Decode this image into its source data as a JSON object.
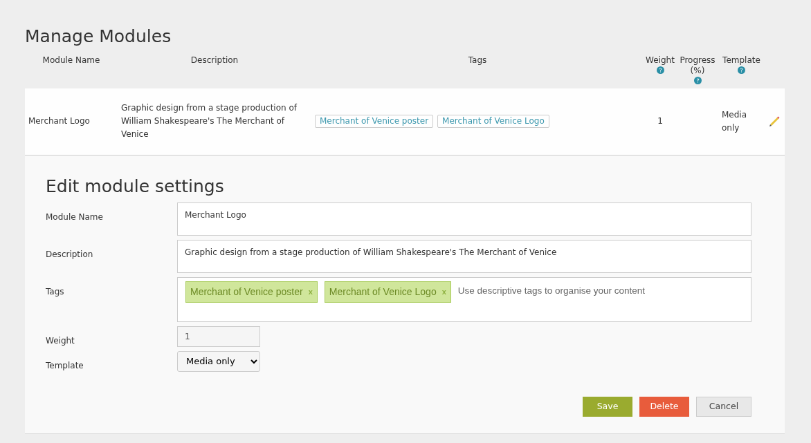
{
  "page_title": "Manage Modules",
  "table": {
    "columns": [
      {
        "label": "Module Name",
        "help": false
      },
      {
        "label": "Description",
        "help": false
      },
      {
        "label": "Tags",
        "help": false
      },
      {
        "label": "Weight",
        "help": true
      },
      {
        "label": "Progress (%)",
        "help": true
      },
      {
        "label": "Template",
        "help": true
      }
    ],
    "rows": [
      {
        "name": "Merchant Logo",
        "description": "Graphic design from a stage production of William Shakespeare's The Merchant of Venice",
        "tags": [
          "Merchant of Venice poster",
          "Merchant of Venice Logo"
        ],
        "weight": "1",
        "template": "Media only",
        "expanded": true
      }
    ]
  },
  "edit_form": {
    "title": "Edit module settings",
    "fields": [
      {
        "kind": "textarea",
        "label": "Module Name",
        "value": "Merchant Logo"
      },
      {
        "kind": "textarea",
        "label": "Description",
        "value": "Graphic design from a stage production of William Shakespeare's The Merchant of Venice"
      },
      {
        "kind": "tags",
        "label": "Tags",
        "tags": [
          {
            "label": "Merchant of Venice poster",
            "remove": "x"
          },
          {
            "label": "Merchant of Venice Logo",
            "remove": "x"
          }
        ],
        "placeholder": "Use descriptive tags to organise your content"
      },
      {
        "kind": "readonly",
        "label": "Weight",
        "value": "1"
      },
      {
        "kind": "select",
        "label": "Template",
        "value": "Media only"
      }
    ],
    "buttons": [
      {
        "label": "Save",
        "kind": "save"
      },
      {
        "label": "Delete",
        "kind": "delete"
      },
      {
        "label": "Cancel",
        "kind": "cancel"
      }
    ]
  }
}
